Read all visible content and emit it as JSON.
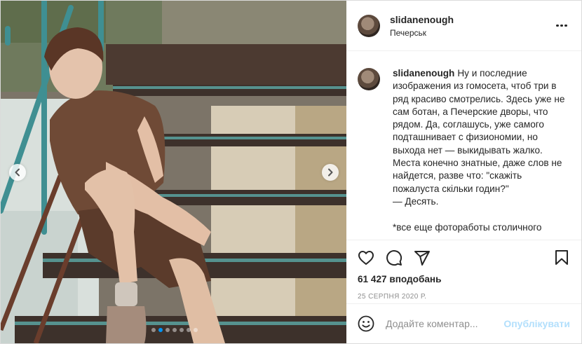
{
  "post": {
    "username": "slidanenough",
    "location": "Печерськ",
    "caption_username": "slidanenough",
    "caption_text": "Ну и последние изображения из гомосета, чтоб три в ряд красиво смотрелись. Здесь уже не сам ботан, а Печерские дворы, что рядом. Да, соглашусь, уже самого подташнивает с физиономии, но выхода нет — выкидывать жалко. Места конечно знатные, даже слов не найдется, разве что: \"скажіть пожалуста скільки годин?\"\n— Десять.\n\n*все еще фотоработы столичного",
    "likes": "61 427 вподобань",
    "date": "25 серпня 2020 р."
  },
  "carousel": {
    "total": 7,
    "active_index": 1
  },
  "comment_box": {
    "placeholder": "Додайте коментар...",
    "publish_label": "Опублікувати"
  },
  "icons": {
    "more": "more-horizontal-icon",
    "like": "heart-icon",
    "comment": "comment-bubble-icon",
    "share": "paper-plane-icon",
    "save": "bookmark-icon",
    "emoji": "smiley-icon",
    "prev": "chevron-left-icon",
    "next": "chevron-right-icon"
  },
  "colors": {
    "accent": "#0095f6",
    "publish_disabled": "#b2dffc",
    "text": "#262626",
    "muted": "#8e8e8e"
  }
}
